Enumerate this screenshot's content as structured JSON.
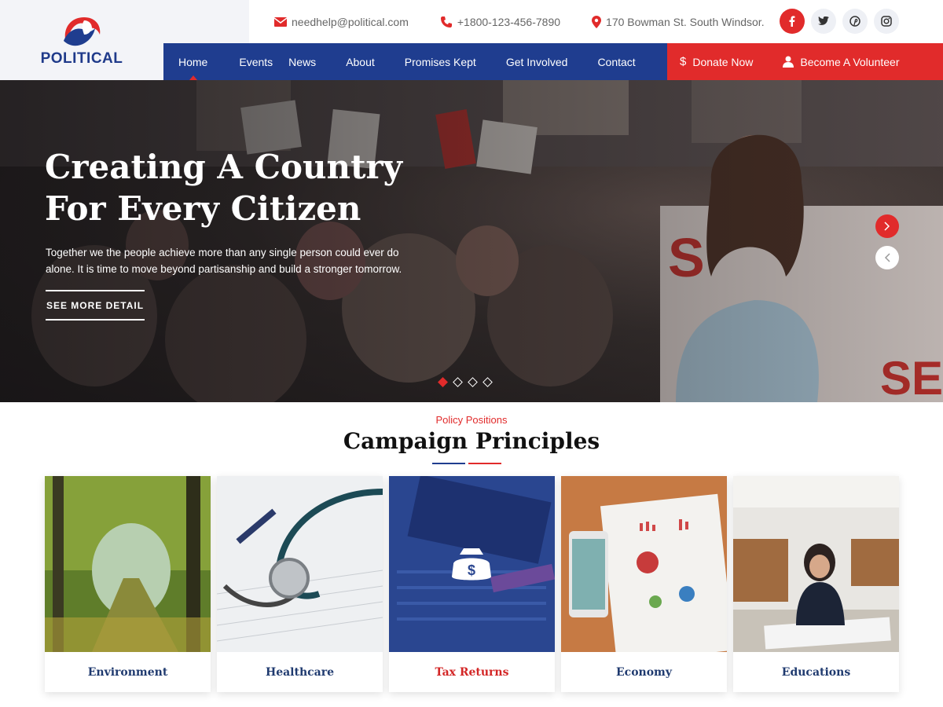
{
  "brand": {
    "name": "POLITICAL"
  },
  "topbar": {
    "email": "needhelp@political.com",
    "phone": "+1800-123-456-7890",
    "address": "170 Bowman St. South Windsor."
  },
  "socials": [
    {
      "icon": "facebook-icon",
      "glyph": "f"
    },
    {
      "icon": "twitter-icon",
      "glyph": "t"
    },
    {
      "icon": "pinterest-icon",
      "glyph": "p"
    },
    {
      "icon": "instagram-icon",
      "glyph": "◎"
    }
  ],
  "nav": {
    "items": [
      {
        "label": "Home",
        "active": true
      },
      {
        "label": "Events"
      },
      {
        "label": "News"
      },
      {
        "label": "About"
      },
      {
        "label": "Promises Kept"
      },
      {
        "label": "Get Involved"
      },
      {
        "label": "Contact"
      }
    ],
    "donate": "Donate Now",
    "volunteer": "Become A Volunteer"
  },
  "hero": {
    "title_line1": "Creating A Country",
    "title_line2": "For Every Citizen",
    "subtitle": "Together we the people achieve more than any single person could ever do alone. It is time to move beyond  partisanship and build a stronger tomorrow.",
    "button": "SEE MORE DETAIL",
    "slides": 4,
    "active_slide": 1
  },
  "principles": {
    "kicker": "Policy Positions",
    "title": "Campaign Principles",
    "cards": [
      {
        "label": "Environment"
      },
      {
        "label": "Healthcare"
      },
      {
        "label": "Tax Returns",
        "highlighted": true
      },
      {
        "label": "Economy"
      },
      {
        "label": "Educations"
      }
    ]
  },
  "colors": {
    "brand_blue": "#1f3d8f",
    "accent_red": "#e12b2b"
  }
}
